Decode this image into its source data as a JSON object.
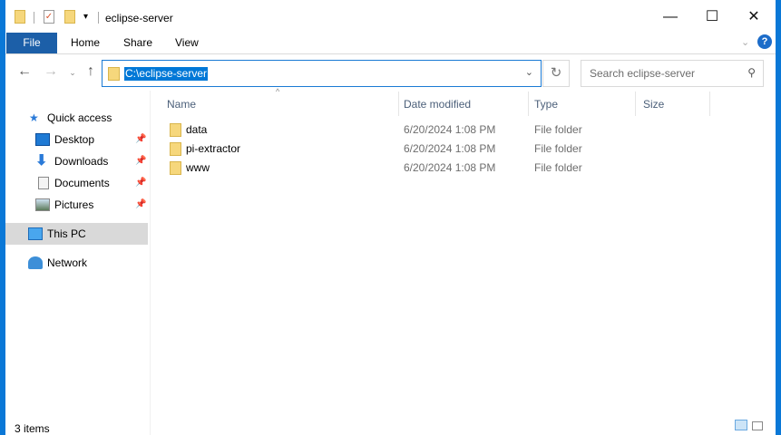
{
  "window": {
    "title": "eclipse-server",
    "minimize": "—",
    "maximize": "☐",
    "close": "✕"
  },
  "ribbon": {
    "tabs": [
      "File",
      "Home",
      "Share",
      "View"
    ],
    "help": "?",
    "collapse": "⌄"
  },
  "address": {
    "path": "C:\\eclipse-server",
    "search_placeholder": "Search eclipse-server"
  },
  "columns": [
    "Name",
    "Date modified",
    "Type",
    "Size"
  ],
  "nav": {
    "items": [
      {
        "label": "Quick access",
        "icon": "star-icon"
      },
      {
        "label": "Desktop",
        "icon": "desktop-icon",
        "pinned": true
      },
      {
        "label": "Downloads",
        "icon": "download-icon",
        "pinned": true
      },
      {
        "label": "Documents",
        "icon": "documents-icon",
        "pinned": true
      },
      {
        "label": "Pictures",
        "icon": "pictures-icon",
        "pinned": true
      },
      {
        "label": "This PC",
        "icon": "pc-icon",
        "selected": true
      },
      {
        "label": "Network",
        "icon": "network-icon"
      }
    ]
  },
  "files": [
    {
      "name": "data",
      "date": "6/20/2024 1:08 PM",
      "type": "File folder",
      "size": ""
    },
    {
      "name": "pi-extractor",
      "date": "6/20/2024 1:08 PM",
      "type": "File folder",
      "size": ""
    },
    {
      "name": "www",
      "date": "6/20/2024 1:08 PM",
      "type": "File folder",
      "size": ""
    }
  ],
  "status": {
    "items": "3 items"
  }
}
